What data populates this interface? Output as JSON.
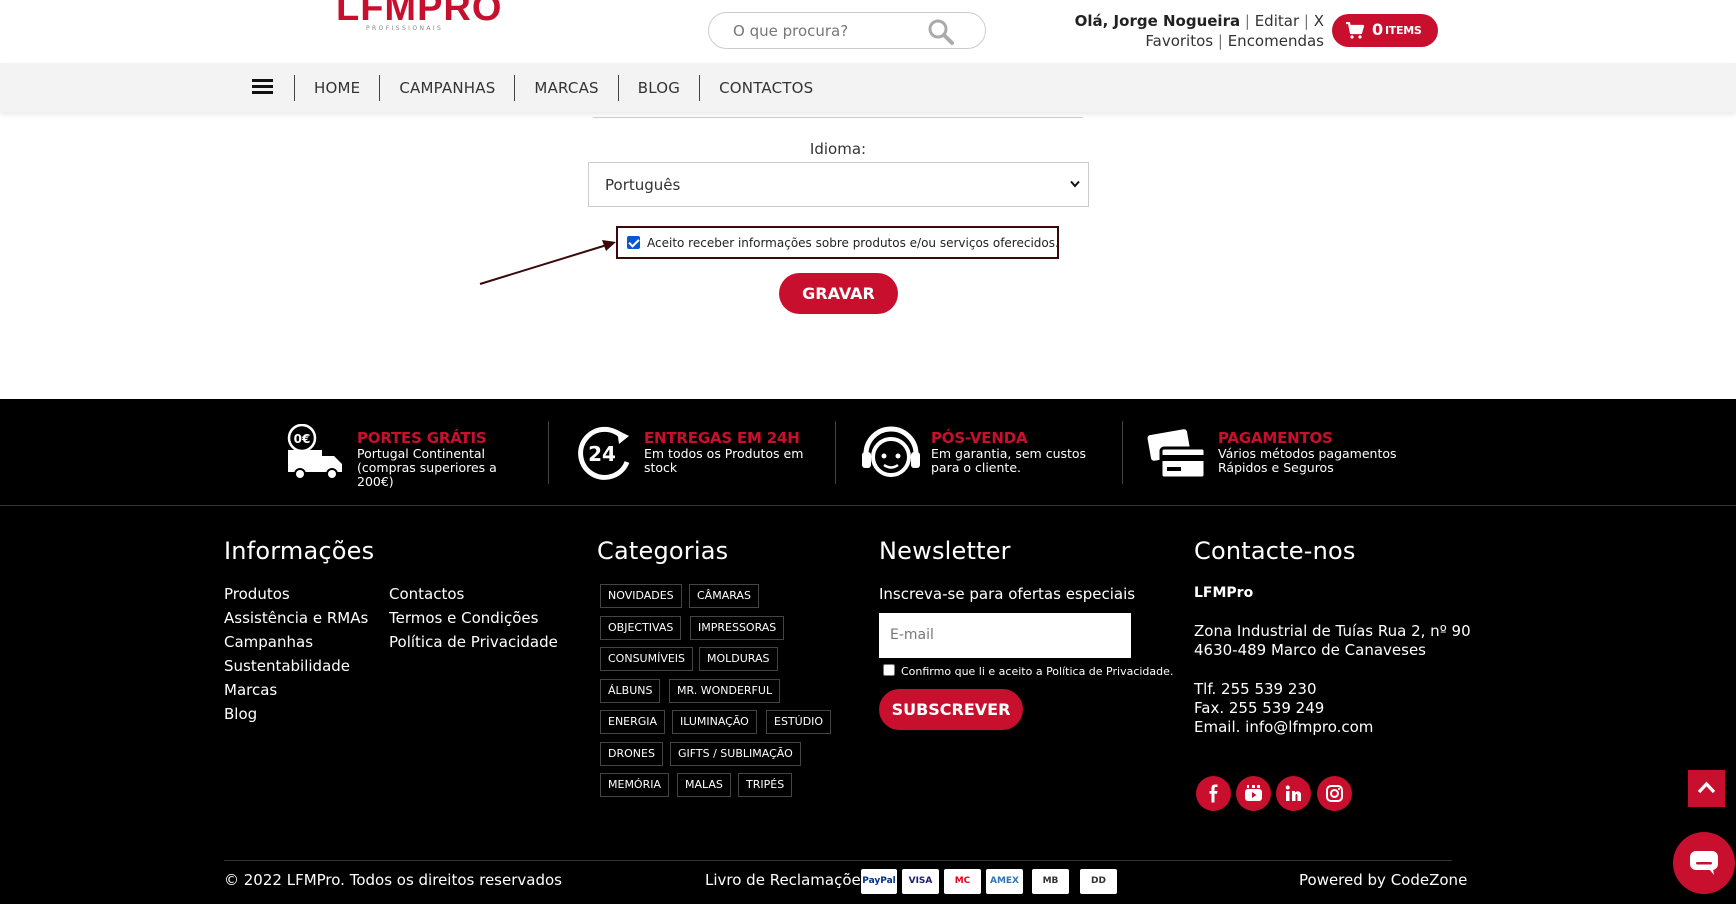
{
  "brand": {
    "logo_text": "LFMPRO",
    "logo_sub": "PROFISSIONAIS"
  },
  "header": {
    "search_placeholder": "O que procura?",
    "greeting": "Olá, Jorge Nogueira",
    "edit_label": "Editar",
    "close_label": "X",
    "favorites_label": "Favoritos",
    "orders_label": "Encomendas",
    "cart_count": "0",
    "cart_label": "ITEMS"
  },
  "nav": {
    "items": [
      "HOME",
      "CAMPANHAS",
      "MARCAS",
      "BLOG",
      "CONTACTOS"
    ]
  },
  "form": {
    "language_label": "Idioma:",
    "language_value": "Português",
    "consent_text": "Aceito receber informações sobre produtos e/ou serviços oferecidos.",
    "consent_checked": true,
    "save_label": "GRAVAR"
  },
  "features": [
    {
      "icon": "free-shipping-truck-icon",
      "title": "PORTES GRÁTIS",
      "desc": "Portugal Continental (compras superiores a 200€)"
    },
    {
      "icon": "24h-delivery-icon",
      "title": "ENTREGAS EM 24H",
      "desc": "Em todos os Produtos em stock"
    },
    {
      "icon": "support-headset-icon",
      "title": "PÓS-VENDA",
      "desc": "Em garantia, sem custos para o cliente."
    },
    {
      "icon": "payment-cards-icon",
      "title": "PAGAMENTOS",
      "desc": "Vários métodos pagamentos Rápidos e Seguros"
    }
  ],
  "info": {
    "title": "Informações",
    "links_col1": [
      "Produtos",
      "Assistência e RMAs",
      "Campanhas",
      "Sustentabilidade",
      "Marcas",
      "Blog"
    ],
    "links_col2": [
      "Contactos",
      "Termos e Condições",
      "Política de Privacidade"
    ]
  },
  "categories": {
    "title": "Categorias",
    "rows": [
      [
        "NOVIDADES",
        "CÂMARAS"
      ],
      [
        "OBJECTIVAS",
        "IMPRESSORAS"
      ],
      [
        "CONSUMÍVEIS",
        "MOLDURAS"
      ],
      [
        "ÁLBUNS",
        "MR. WONDERFUL"
      ],
      [
        "ENERGIA",
        "ILUMINAÇÃO",
        "ESTÚDIO"
      ],
      [
        "DRONES",
        "GIFTS / SUBLIMAÇÃO"
      ],
      [
        "MEMÓRIA",
        "MALAS",
        "TRIPÉS"
      ]
    ]
  },
  "newsletter": {
    "title": "Newsletter",
    "subtitle": "Inscreva-se para ofertas especiais",
    "email_placeholder": "E-mail",
    "confirm_text": "Confirmo que li e aceito a Política de Privacidade.",
    "button_label": "SUBSCREVER"
  },
  "contact": {
    "title": "Contacte-nos",
    "company": "LFMPro",
    "address1": "Zona Industrial de Tuías Rua 2, nº 90",
    "address2": "4630-489 Marco de Canaveses",
    "phone": "Tlf. 255 539 230",
    "fax": "Fax. 255 539 249",
    "email": "Email. info@lfmpro.com",
    "social": [
      "facebook-icon",
      "youtube-icon",
      "linkedin-icon",
      "instagram-icon"
    ]
  },
  "bottom": {
    "copyright": "© 2022 LFMPro. Todos os direitos reservados",
    "complaints": "Livro de Reclamações",
    "payments": [
      "PayPal",
      "VISA",
      "MC",
      "AMEX",
      "MB",
      "DD"
    ],
    "powered_by": "Powered by CodeZone"
  },
  "colors": {
    "accent": "#c8102e",
    "footer_bg": "#000000",
    "nav_bg": "#f3f3f3"
  }
}
